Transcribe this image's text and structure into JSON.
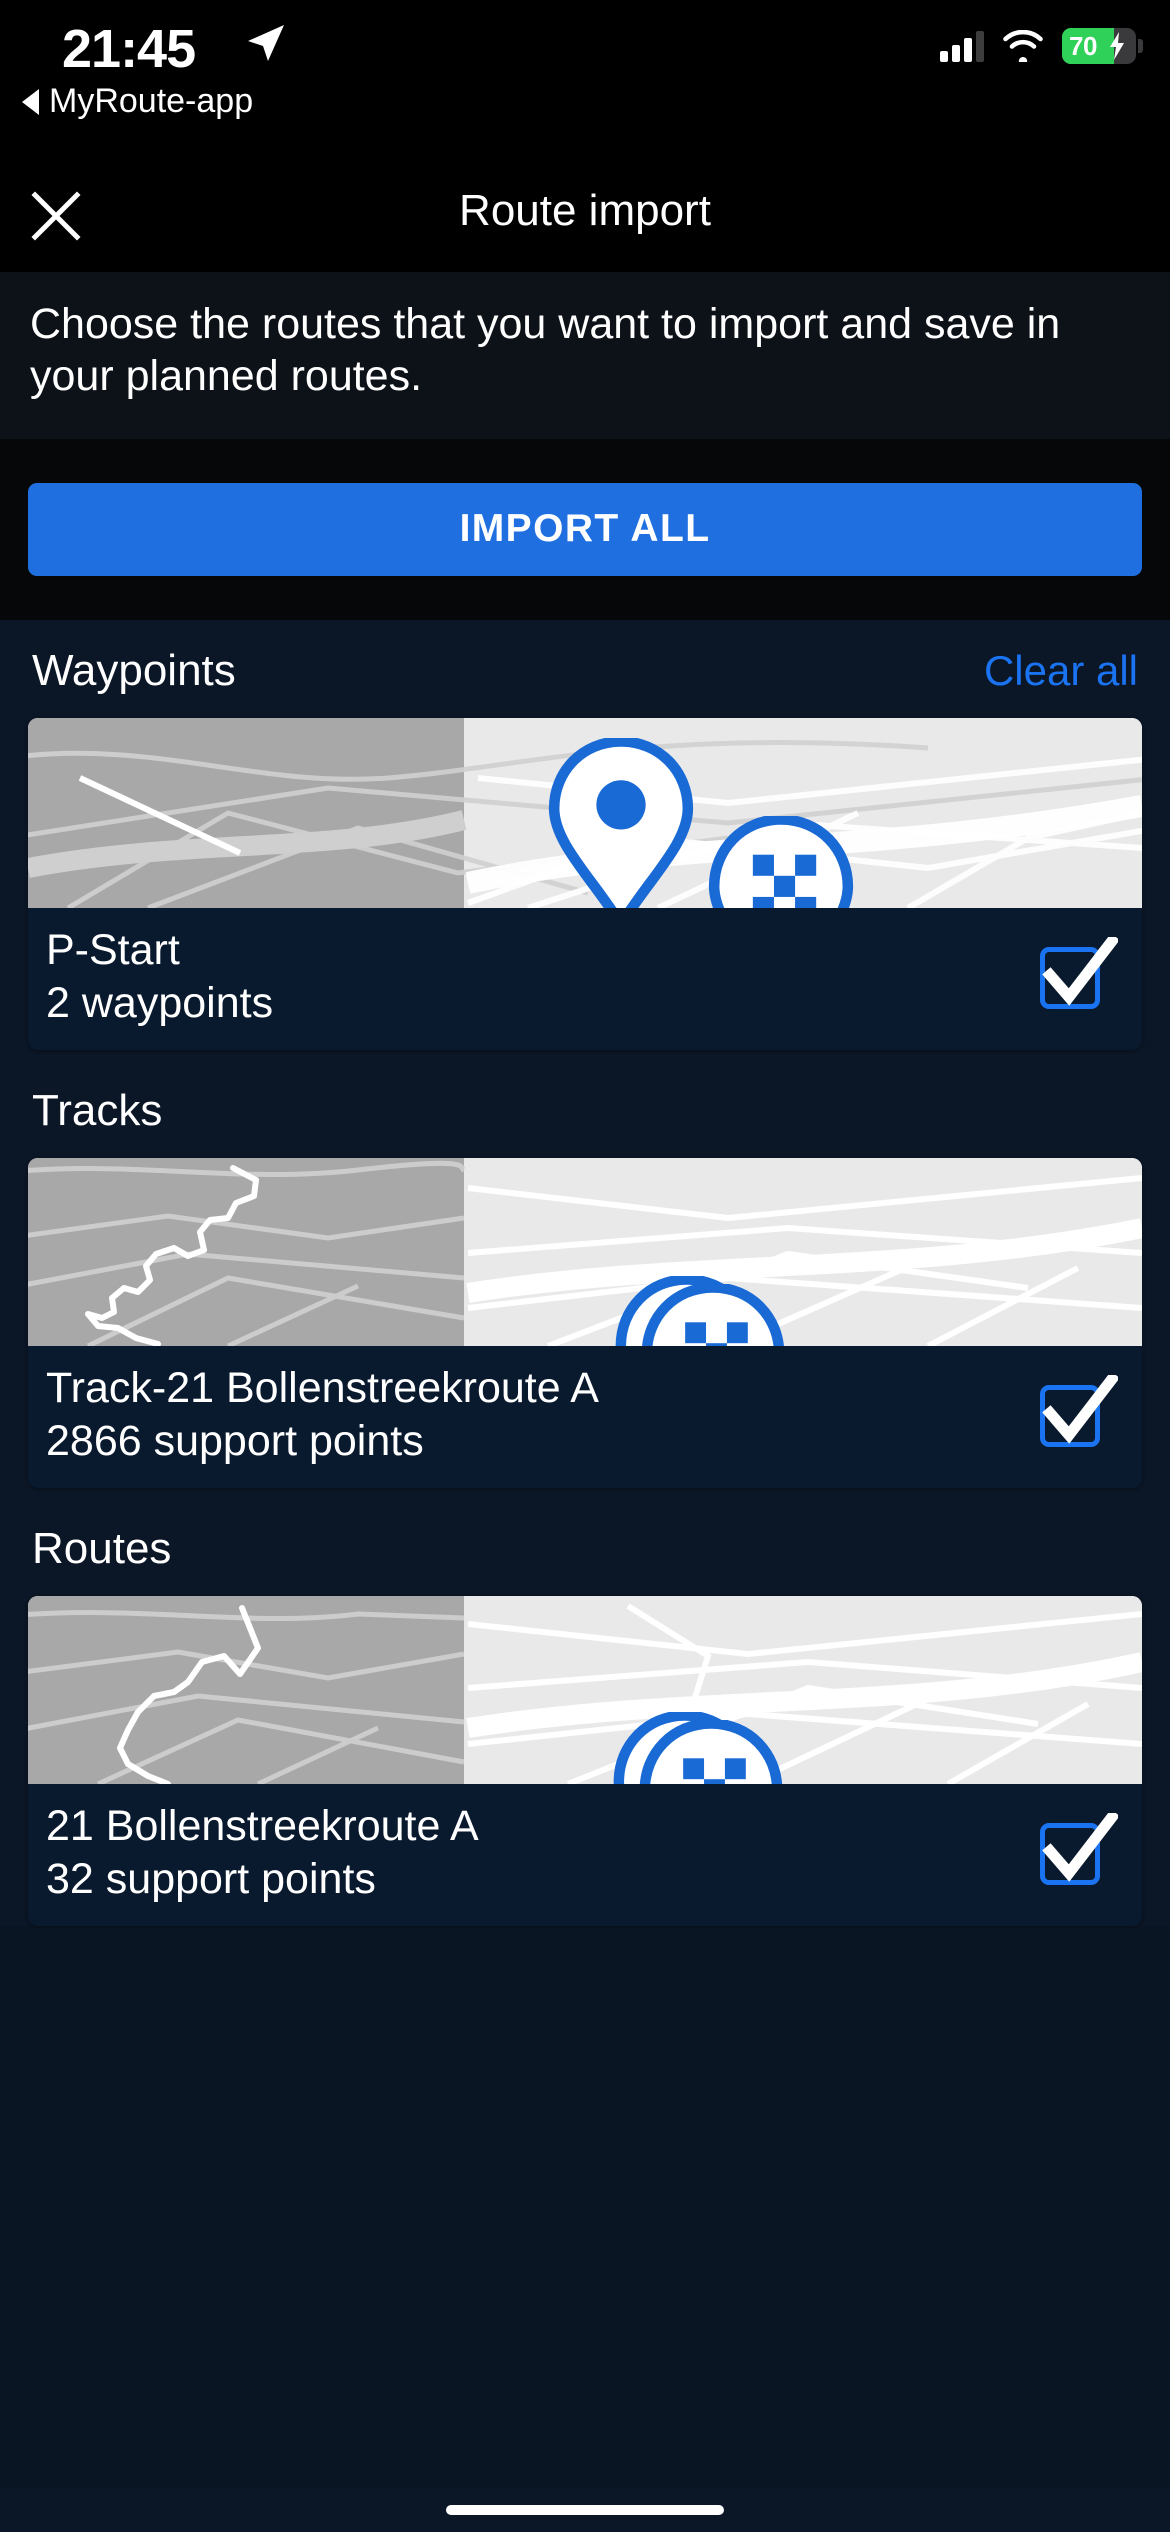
{
  "statusbar": {
    "time": "21:45",
    "back_label": "MyRoute-app",
    "battery_pct": "70",
    "location_icon": "location-arrow-icon",
    "signal_icon": "cellular-signal-icon",
    "wifi_icon": "wifi-icon",
    "battery_icon": "battery-charging-icon"
  },
  "header": {
    "title": "Route import",
    "close_icon": "close-x-icon"
  },
  "description": {
    "text": "Choose the routes that you want to import and save in your planned routes."
  },
  "toolbar": {
    "import_all_label": "IMPORT ALL",
    "accent_color": "#1f6fe0"
  },
  "sections": [
    {
      "title": "Waypoints",
      "action_label": "Clear all",
      "action_color": "#1a73f0",
      "items": [
        {
          "name": "P-Start",
          "subtitle": "2 waypoints",
          "checked": true,
          "map_type": "waypoints",
          "pins": [
            "start-pin-icon",
            "finish-flag-pin-icon"
          ]
        }
      ]
    },
    {
      "title": "Tracks",
      "action_label": "",
      "items": [
        {
          "name": "Track-21 Bollenstreekroute A",
          "subtitle": "2866 support points",
          "checked": true,
          "map_type": "track",
          "pins": [
            "start-pin-icon",
            "finish-flag-pin-icon"
          ]
        }
      ]
    },
    {
      "title": "Routes",
      "action_label": "",
      "items": [
        {
          "name": "21 Bollenstreekroute A",
          "subtitle": "32 support points",
          "checked": true,
          "map_type": "route",
          "pins": [
            "start-pin-icon",
            "finish-flag-pin-icon"
          ]
        }
      ]
    }
  ]
}
